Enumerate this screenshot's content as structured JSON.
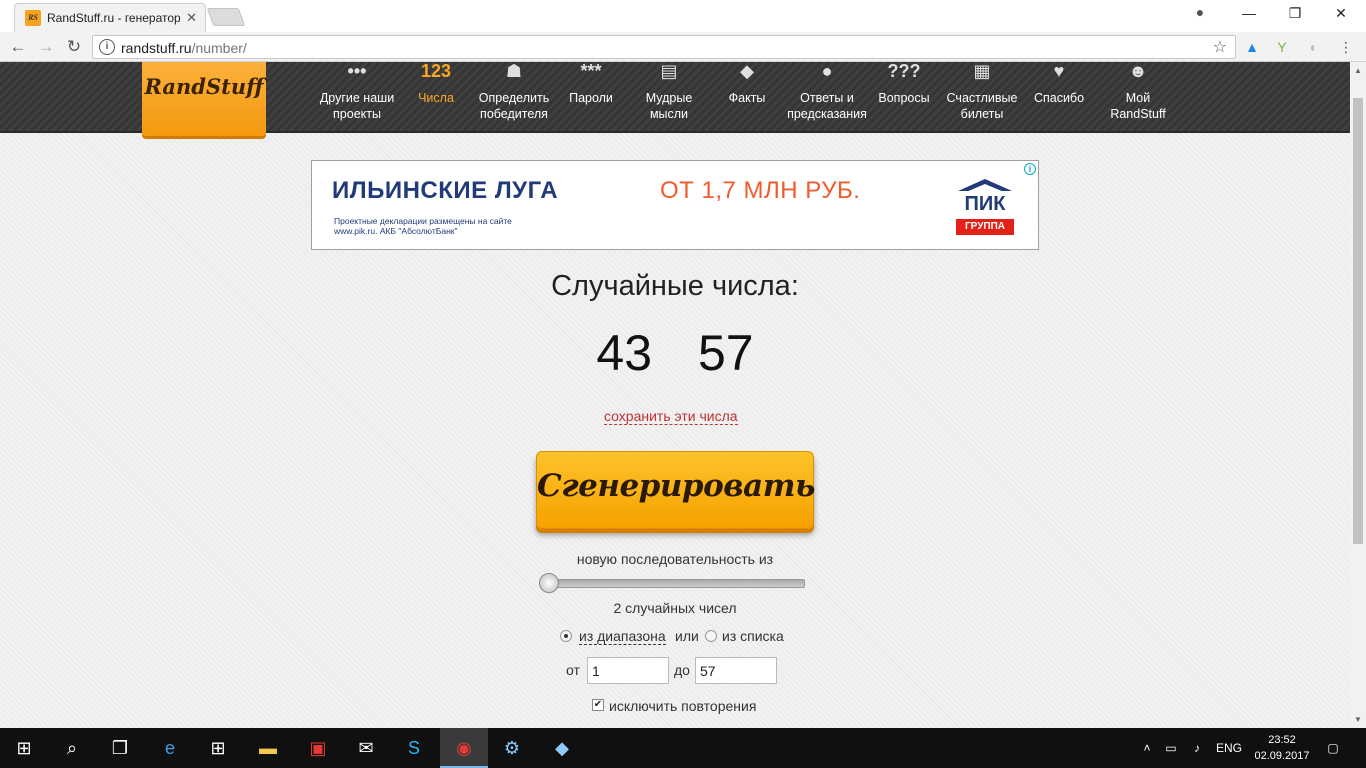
{
  "browser": {
    "tab_title": "RandStuff.ru - генератор",
    "tab_favicon": "RS",
    "url_host": "randstuff.ru",
    "url_path": "/number/"
  },
  "site_nav": {
    "logo": "RandStuff",
    "items": [
      {
        "icon": "•••",
        "label": "Другие наши проекты",
        "active": false
      },
      {
        "icon": "123",
        "label": "Числа",
        "active": true
      },
      {
        "icon": "☗",
        "label": "Определить победителя",
        "active": false
      },
      {
        "icon": "***",
        "label": "Пароли",
        "active": false
      },
      {
        "icon": "▤",
        "label": "Мудрые мысли",
        "active": false
      },
      {
        "icon": "◆",
        "label": "Факты",
        "active": false
      },
      {
        "icon": "●",
        "label": "Ответы и предсказания",
        "active": false
      },
      {
        "icon": "???",
        "label": "Вопросы",
        "active": false
      },
      {
        "icon": "▦",
        "label": "Счастливые билеты",
        "active": false
      },
      {
        "icon": "♥",
        "label": "Спасибо",
        "active": false
      },
      {
        "icon": "☻",
        "label": "Мой RandStuff",
        "active": false
      }
    ]
  },
  "ad": {
    "headline": "ИЛЬИНСКИЕ ЛУГА",
    "price": "ОТ 1,7 МЛН РУБ.",
    "legal": "Проектные декларации размещены на сайте www.pik.ru. АКБ \"АбсолютБанк\"",
    "brand": "ПИК",
    "brand_sub": "ГРУППА",
    "brand_colors": {
      "blue": "#213a78",
      "red": "#e32119",
      "price": "#f15a29"
    }
  },
  "result": {
    "title": "Случайные числа:",
    "numbers": [
      "43",
      "57"
    ],
    "save_link": "сохранить эти числа"
  },
  "generator": {
    "button_label": "Сгенерировать",
    "sequence_label": "новую последовательность из",
    "slider_value": 2,
    "count_label": "2 случайных чисел",
    "source_range_label": "из диапазона",
    "source_or": "или",
    "source_list_label": "из списка",
    "source_selected": "range",
    "from_label": "от",
    "from_value": "1",
    "to_label": "до",
    "to_value": "57",
    "exclude_label": "исключить повторения",
    "exclude_checked": true
  },
  "taskbar": {
    "lang": "ENG",
    "time": "23:52",
    "date": "02.09.2017"
  }
}
